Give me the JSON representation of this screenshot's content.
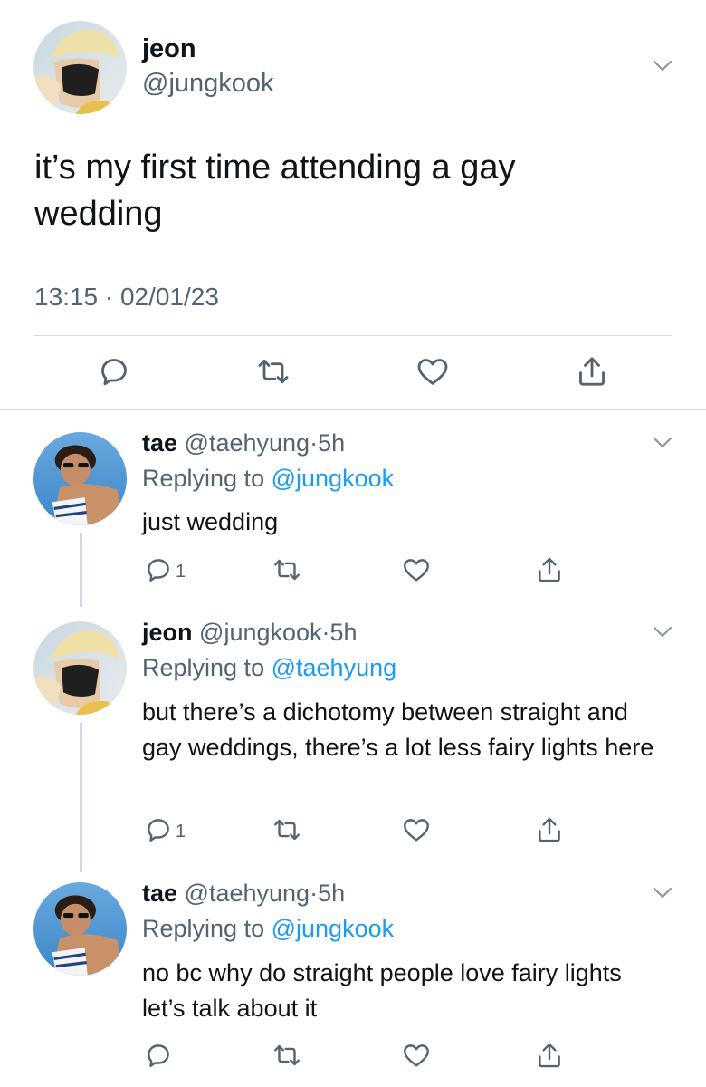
{
  "main_tweet": {
    "display_name": "jeon",
    "handle": "@jungkook",
    "text": "it’s my first time attending a gay wedding",
    "timestamp": "13:15 · 02/01/23",
    "avatar_icon": "avatar-photo-icon"
  },
  "replies": [
    {
      "display_name": "tae",
      "handle": "@taehyung",
      "sep": "·",
      "age": "5h",
      "replying_prefix": "Replying to",
      "replying_mention": "@jungkook",
      "text": "just wedding",
      "reply_count": "1"
    },
    {
      "display_name": "jeon",
      "handle": "@jungkook",
      "sep": "·",
      "age": "5h",
      "replying_prefix": "Replying to",
      "replying_mention": "@taehyung",
      "text": "but there’s a dichotomy between straight and gay weddings, there’s a lot less fairy lights here",
      "reply_count": "1"
    },
    {
      "display_name": "tae",
      "handle": "@taehyung",
      "sep": "·",
      "age": "5h",
      "replying_prefix": "Replying to",
      "replying_mention": "@jungkook",
      "text": "no bc why do straight people love fairy lights let’s talk about it",
      "reply_count": ""
    }
  ],
  "colors": {
    "text": "#0f1419",
    "secondary": "#536471",
    "link": "#1d9bf0",
    "divider": "#cfd9de"
  }
}
